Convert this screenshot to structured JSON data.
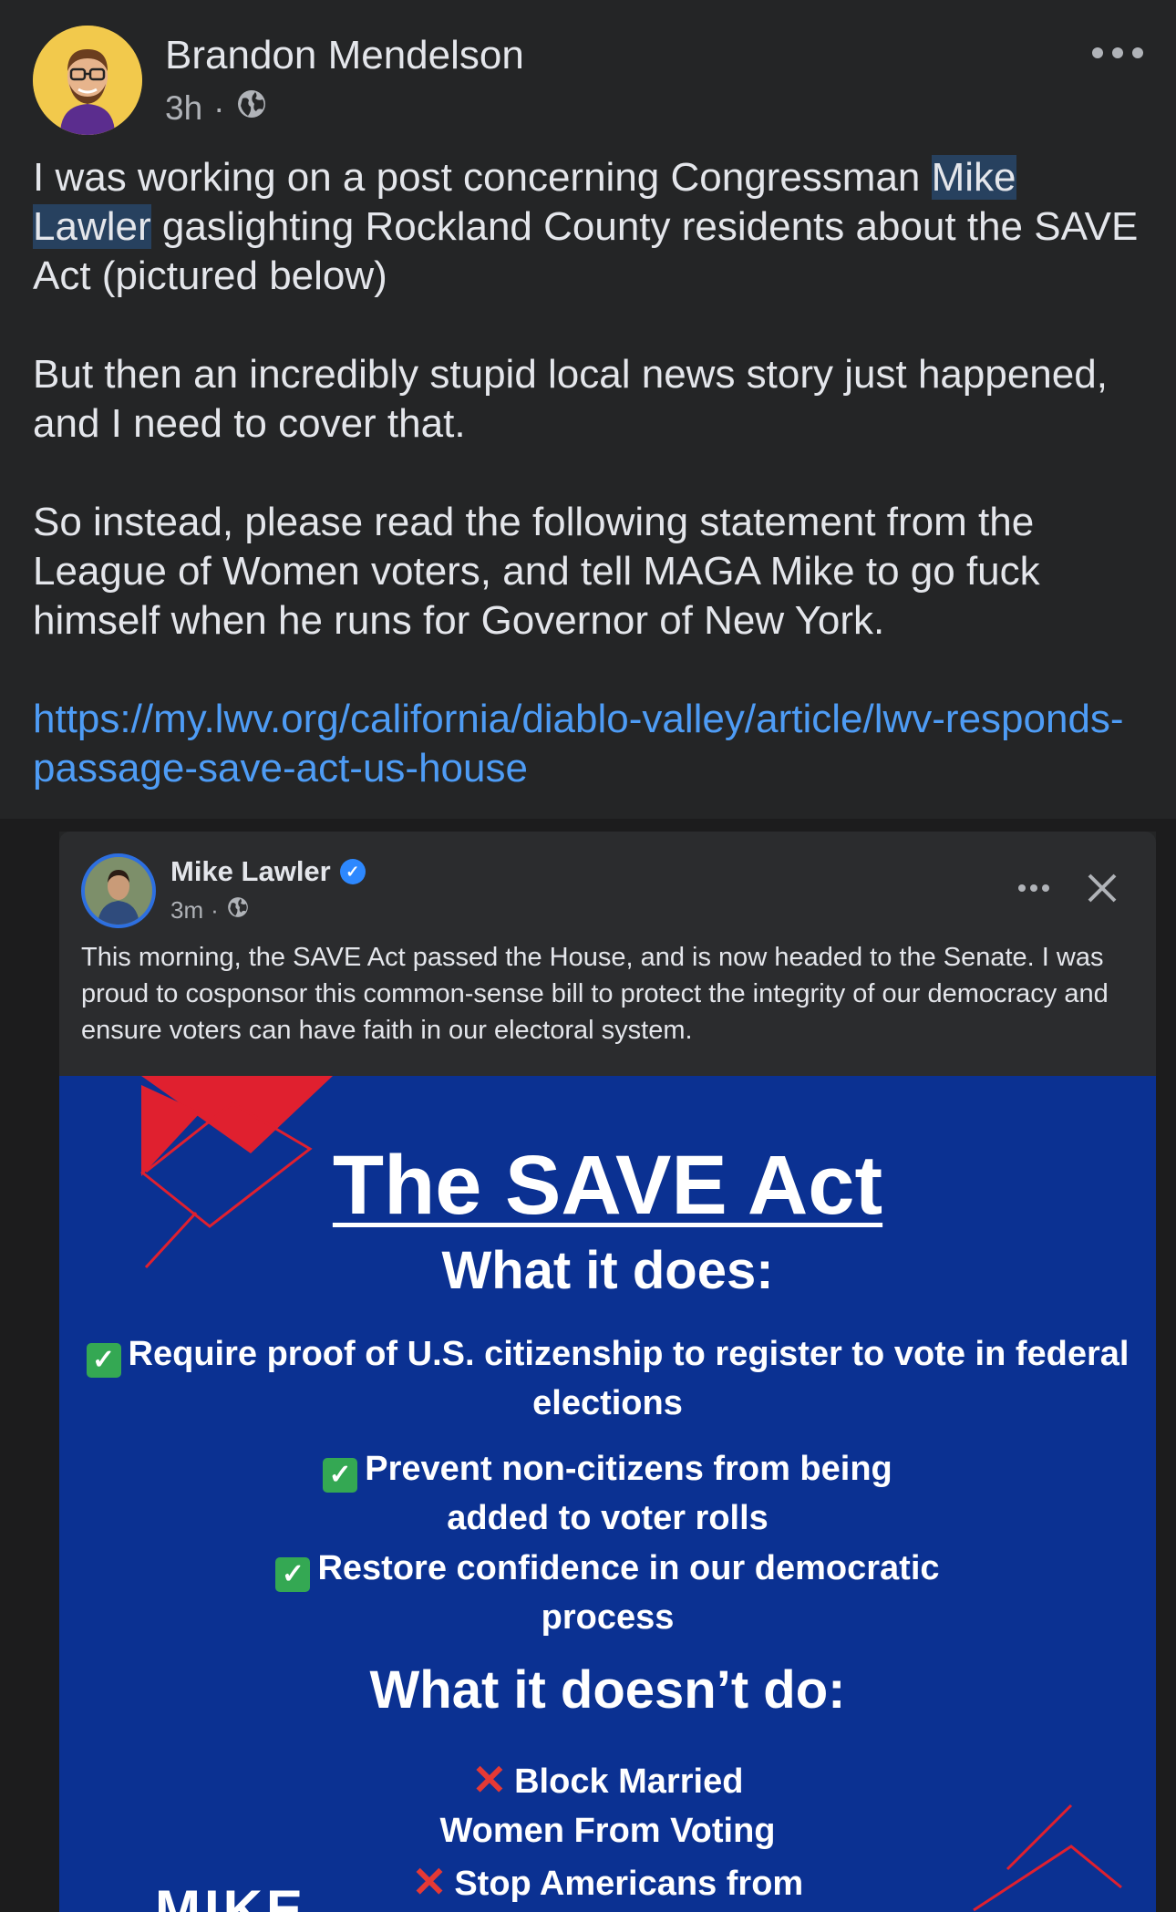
{
  "post": {
    "author": "Brandon Mendelson",
    "time": "3h",
    "privacy_icon": "globe-icon",
    "paragraph1_pre": "I was working on a post concerning Congressman ",
    "paragraph1_highlight": "Mike Lawler",
    "paragraph1_post": " gaslighting Rockland County residents about the SAVE Act (pictured below)",
    "paragraph2": "But then an incredibly stupid local news story just happened, and I need to cover that.",
    "paragraph3": "So instead, please read the following statement from the League of Women voters, and tell MAGA Mike to go fuck himself when he runs for Governor of New York.",
    "link": "https://my.lwv.org/california/diablo-valley/article/lwv-responds-passage-save-act-us-house"
  },
  "shared": {
    "author": "Mike Lawler",
    "time": "3m",
    "text": "This morning, the SAVE Act passed the House, and is now headed to the Senate. I was proud to cosponsor this common-sense bill to protect the integrity of our democracy and ensure voters can have faith in our electoral system."
  },
  "graphic": {
    "title": "The SAVE Act",
    "does_heading": "What it does:",
    "does_items": [
      "Require proof of U.S. citizenship to register to vote in federal elections",
      "Prevent non-citizens from being added to voter rolls",
      "Restore confidence in our democratic process"
    ],
    "doesnt_heading": "What it doesn’t do:",
    "doesnt_items": [
      "Block Married Women From Voting",
      "Stop Americans from"
    ],
    "logo_text": "MIKE"
  },
  "colors": {
    "background": "#242526",
    "link": "#4e9cf5",
    "graphic_bg": "#0b3192",
    "accent_red": "#e0202f",
    "check_green": "#34a853"
  }
}
